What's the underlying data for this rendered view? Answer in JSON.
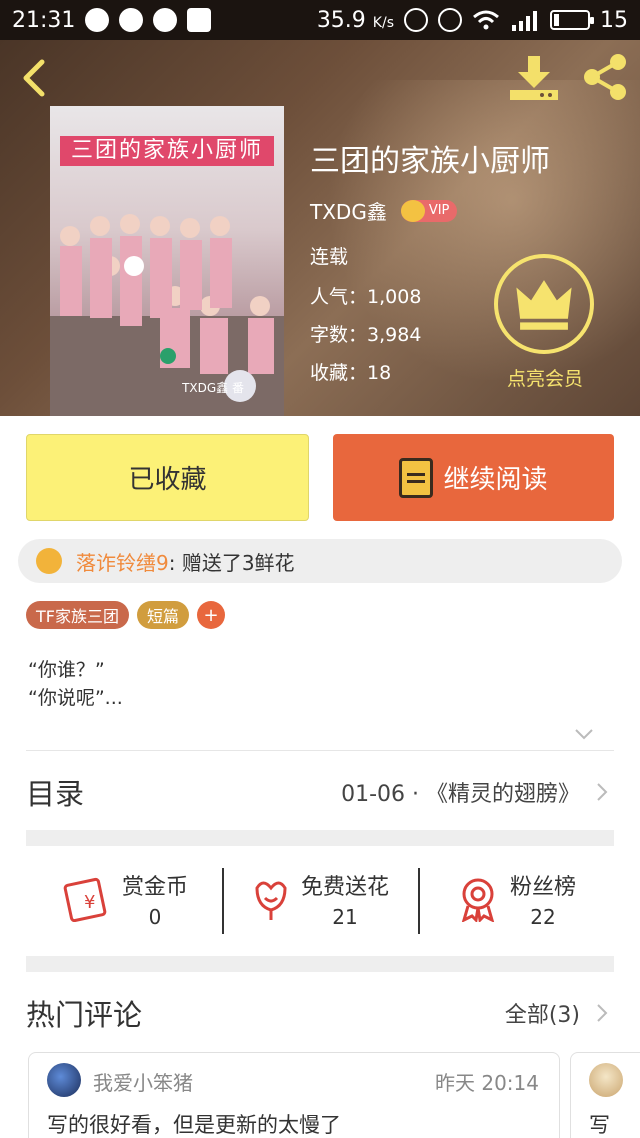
{
  "status_bar": {
    "time": "21:31",
    "speed": "35.9",
    "speed_unit": "K/s",
    "battery": "15",
    "battery_level": 0.15,
    "icons": [
      "chat-icon",
      "message-icon",
      "location-icon",
      "mail-icon",
      "mute-icon",
      "alarm-icon",
      "wifi-icon",
      "signal-icon",
      "battery-icon"
    ]
  },
  "header": {
    "icons": [
      "back-arrow-icon",
      "download-icon",
      "share-icon"
    ],
    "cover_banner": "三团的家族小厨师",
    "cover_watermark": "TXDG鑫 番",
    "title": "三团的家族小厨师",
    "author": "TXDG鑫",
    "vip_label": "VIP",
    "status": "连载",
    "popularity_label": "人气：",
    "popularity": "1,008",
    "word_count_label": "字数：",
    "word_count": "3,984",
    "favorites_label": "收藏：",
    "favorites": "18",
    "member_label": "点亮会员"
  },
  "actions": {
    "collected_label": "已收藏",
    "read_label": "继续阅读"
  },
  "gift": {
    "user": "落诈铃缮9",
    "message": ": 赠送了3鲜花"
  },
  "tags": [
    "TF家族三团",
    "短篇",
    "+"
  ],
  "summary": {
    "line1": "“你谁？”",
    "line2": "“你说呢”..."
  },
  "toc": {
    "title": "目录",
    "latest_chapter": "01-06 · 《精灵的翅膀》"
  },
  "stats": [
    {
      "label": "赏金币",
      "count": "0",
      "icon": "red-envelope-icon"
    },
    {
      "label": "免费送花",
      "count": "21",
      "icon": "flower-icon"
    },
    {
      "label": "粉丝榜",
      "count": "22",
      "icon": "medal-icon"
    }
  ],
  "comments": {
    "title": "热门评论",
    "all_label": "全部(3)",
    "items": [
      {
        "user": "我爱小笨猪",
        "time": "昨天 20:14",
        "text": "写的很好看，但是更新的太慢了"
      },
      {
        "text": "写"
      }
    ]
  },
  "colors": {
    "accent_orange": "#e8673d",
    "collected_yellow": "#fcf177",
    "member_gold": "#f6e36e",
    "gift_user_orange": "#f08a3c"
  }
}
